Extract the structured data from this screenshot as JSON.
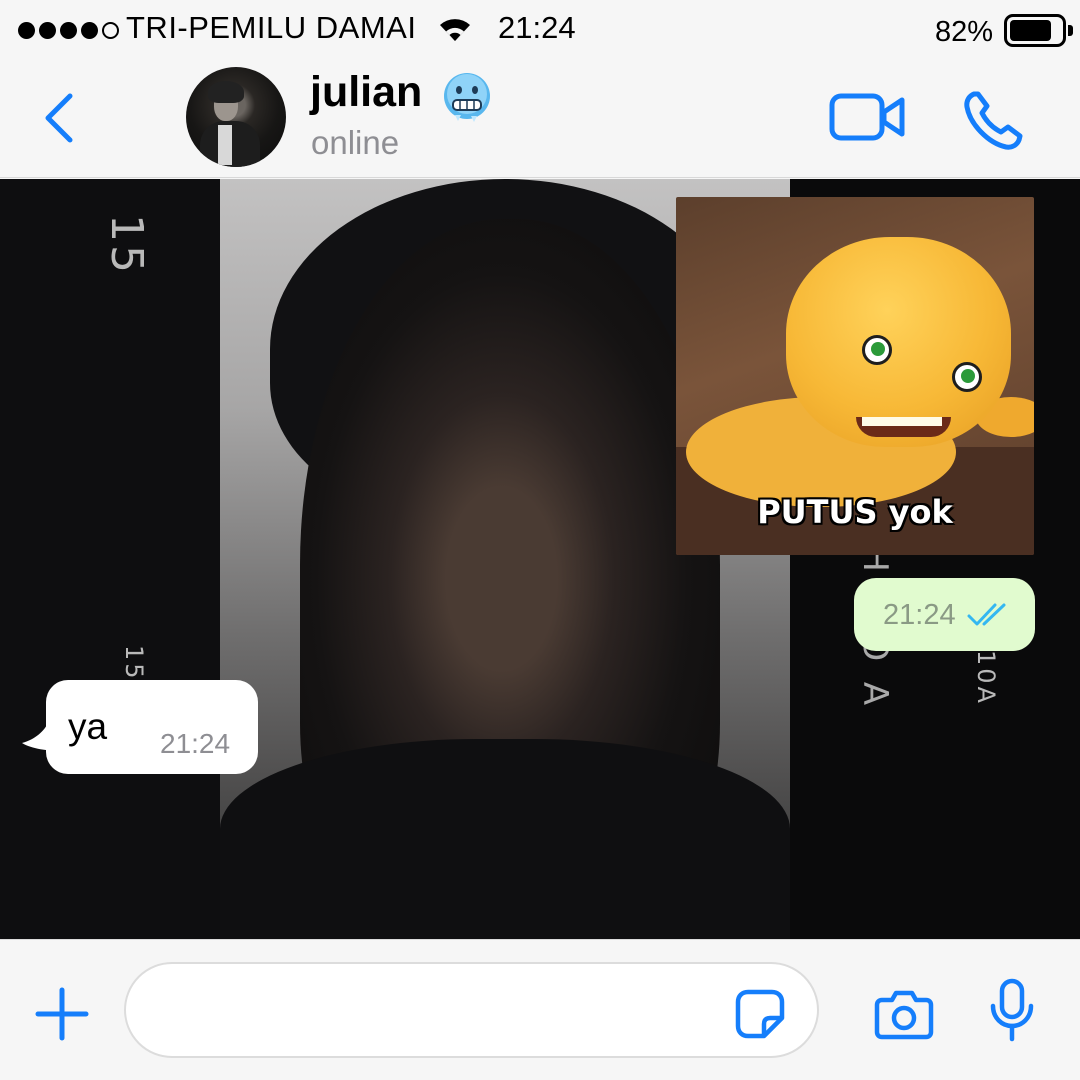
{
  "status_bar": {
    "carrier": "TRI-PEMILU DAMAI",
    "time": "21:24",
    "battery_percent": "82%",
    "battery_level": 0.82,
    "signal_bars_filled": 4,
    "signal_bars_total": 5
  },
  "header": {
    "contact_name": "julian",
    "name_emoji": "cold-face-emoji",
    "presence": "online",
    "accent_color": "#157efb"
  },
  "messages": [
    {
      "direction": "outgoing",
      "type": "sticker",
      "sticker_caption": "PUTUS yok",
      "time": "21:24",
      "status": "read"
    },
    {
      "direction": "incoming",
      "type": "text",
      "text": "ya",
      "time": "21:24"
    }
  ],
  "wallpaper": {
    "film_numbers": [
      "15",
      "15A",
      "10A"
    ],
    "film_brand": "EAPHOTO A"
  },
  "composer": {
    "placeholder": "",
    "icons": [
      "plus-icon",
      "sticker-icon",
      "camera-icon",
      "microphone-icon"
    ]
  },
  "colors": {
    "outgoing_bubble": "#e1fbcf",
    "incoming_bubble": "#ffffff",
    "read_ticks": "#34b7f1",
    "chrome_background": "#f6f6f6"
  }
}
